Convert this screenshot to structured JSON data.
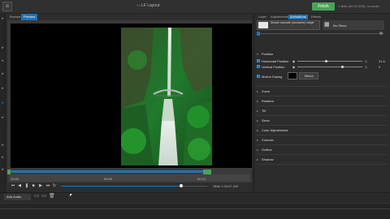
{
  "app": {
    "title": "LF Layout",
    "finish_label": "Finish",
    "slide_info": "1 slide (00:10.000), no audio"
  },
  "preview_tabs": [
    {
      "label": "Browse"
    },
    {
      "label": "Preview"
    }
  ],
  "right_tabs": [
    {
      "label": "Layer"
    },
    {
      "label": "Adjustments"
    },
    {
      "label": "Animations"
    },
    {
      "label": "Effects"
    }
  ],
  "animation": {
    "selected_label": "Simple cascade (clockwise) shape",
    "no_show_label": "No Show"
  },
  "position_section": {
    "title": "Position"
  },
  "properties": [
    {
      "label": "Horizontal Position",
      "value": "21.6",
      "checked": true
    },
    {
      "label": "Vertical Position",
      "value": "0",
      "checked": true
    },
    {
      "label": "Motion Easing",
      "checked": true,
      "select_label": "Select"
    }
  ],
  "sections": [
    {
      "label": "Zoom"
    },
    {
      "label": "Rotation"
    },
    {
      "label": "Tilt"
    },
    {
      "label": "Skew"
    },
    {
      "label": "Color Adjustments"
    },
    {
      "label": "Colorize"
    },
    {
      "label": "Outline"
    },
    {
      "label": "Shadow"
    }
  ],
  "timeline": {
    "ticks": [
      "00:00",
      "00:05",
      "00:10"
    ]
  },
  "transport": {
    "slide_time": "Slide 1   00:07.343"
  },
  "bottom": {
    "add_audio_label": "Add Audio"
  },
  "colors": {
    "accent": "#1f73b7",
    "finish": "#4aa35a"
  }
}
